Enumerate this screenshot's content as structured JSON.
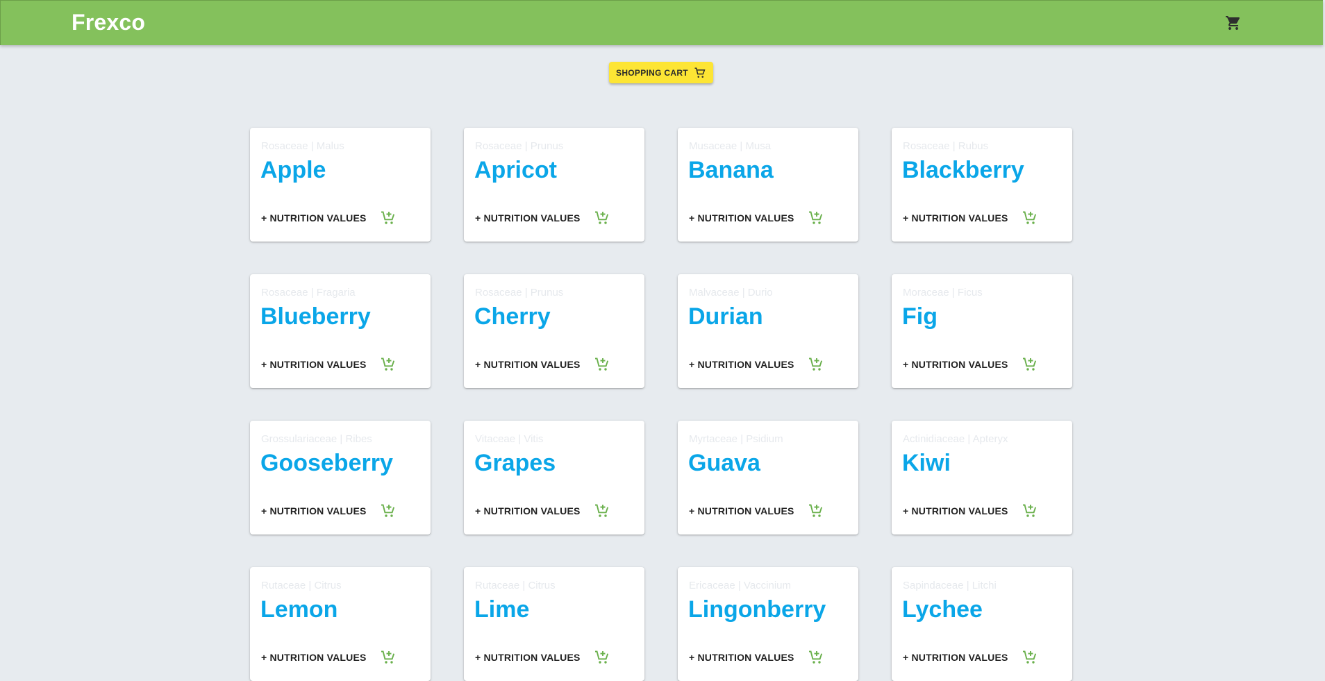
{
  "app": {
    "title": "Frexco"
  },
  "header": {
    "cart_icon": "shopping-cart-icon"
  },
  "cart_button": {
    "label": "SHOPPING CART",
    "icon": "shopping-cart-icon"
  },
  "colors": {
    "appbar": "#84c15c",
    "cart_button": "#fde534",
    "fruit_name": "#0aa6e8",
    "add_cart_icon": "#6ab04c",
    "background": "#e7ebef"
  },
  "card_actions": {
    "nutrition_label": "+ NUTRITION VALUES",
    "add_icon": "add-shopping-cart-icon"
  },
  "fruits": [
    {
      "family": "Rosaceae | Malus",
      "name": "Apple"
    },
    {
      "family": "Rosaceae | Prunus",
      "name": "Apricot"
    },
    {
      "family": "Musaceae | Musa",
      "name": "Banana"
    },
    {
      "family": "Rosaceae | Rubus",
      "name": "Blackberry"
    },
    {
      "family": "Rosaceae | Fragaria",
      "name": "Blueberry"
    },
    {
      "family": "Rosaceae | Prunus",
      "name": "Cherry"
    },
    {
      "family": "Malvaceae | Durio",
      "name": "Durian"
    },
    {
      "family": "Moraceae | Ficus",
      "name": "Fig"
    },
    {
      "family": "Grossulariaceae | Ribes",
      "name": "Gooseberry"
    },
    {
      "family": "Vitaceae | Vitis",
      "name": "Grapes"
    },
    {
      "family": "Myrtaceae | Psidium",
      "name": "Guava"
    },
    {
      "family": "Actinidiaceae | Apteryx",
      "name": "Kiwi"
    },
    {
      "family": "Rutaceae | Citrus",
      "name": "Lemon"
    },
    {
      "family": "Rutaceae | Citrus",
      "name": "Lime"
    },
    {
      "family": "Ericaceae | Vaccinium",
      "name": "Lingonberry"
    },
    {
      "family": "Sapindaceae | Litchi",
      "name": "Lychee"
    }
  ]
}
